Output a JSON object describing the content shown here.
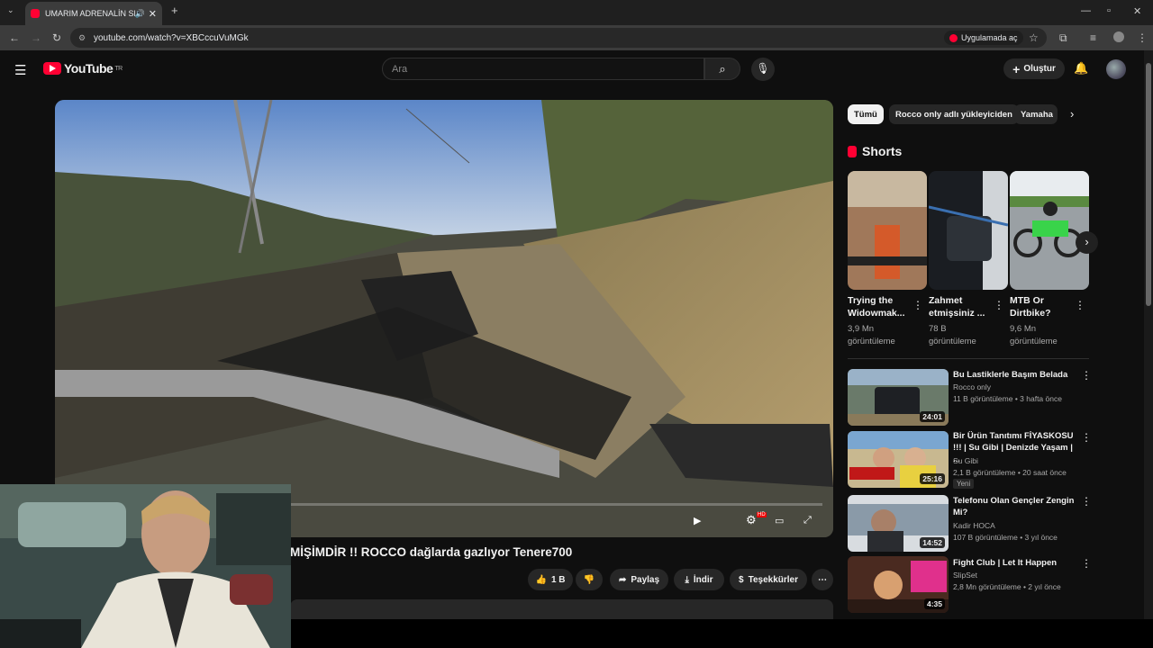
{
  "browser": {
    "tab_title": "UMARIM ADRENALİN SEV...",
    "url": "youtube.com/watch?v=XBCccuVuMGk",
    "open_in_app": "Uygulamada aç"
  },
  "header": {
    "logo_text": "YouTube",
    "country": "TR",
    "search_placeholder": "Ara",
    "create_label": "Oluştur"
  },
  "video": {
    "title": "MİŞİMDİR !! ROCCO dağlarda gazlıyor Tenere700",
    "hd_badge": "HD"
  },
  "actions": {
    "likes": "1 B",
    "share": "Paylaş",
    "download": "İndir",
    "thanks": "Teşekkürler"
  },
  "chips": [
    "Tümü",
    "Rocco only adlı yükleyiciden",
    "Yamaha"
  ],
  "shorts": {
    "heading": "Shorts",
    "items": [
      {
        "title": "Trying the Widowmak...",
        "views": "3,9 Mn görüntüleme"
      },
      {
        "title": "Zahmet etmişsiniz ...",
        "views": "78 B görüntüleme"
      },
      {
        "title": "MTB Or Dirtbike?",
        "views": "9,6 Mn görüntüleme"
      }
    ]
  },
  "related": [
    {
      "title": "Bu Lastiklerle Başım Belada",
      "channel": "Rocco only",
      "meta": "11 B görüntüleme • 3 hafta önce",
      "duration": "24:01"
    },
    {
      "title": "Bir Ürün Tanıtımı FİYASKOSU !!! | Su Gibi | Denizde Yaşam | ...",
      "channel": "Su Gibi",
      "meta": "2,1 B görüntüleme • 20 saat önce",
      "duration": "25:16",
      "badge": "Yeni"
    },
    {
      "title": "Telefonu Olan Gençler Zengin Mi?",
      "channel": "Kadir HOCA",
      "meta": "107 B görüntüleme • 3 yıl önce",
      "duration": "14:52"
    },
    {
      "title": "Fight Club | Let It Happen",
      "channel": "SlipSet",
      "meta": "2,8 Mn görüntüleme • 2 yıl önce",
      "duration": "4:35"
    }
  ]
}
